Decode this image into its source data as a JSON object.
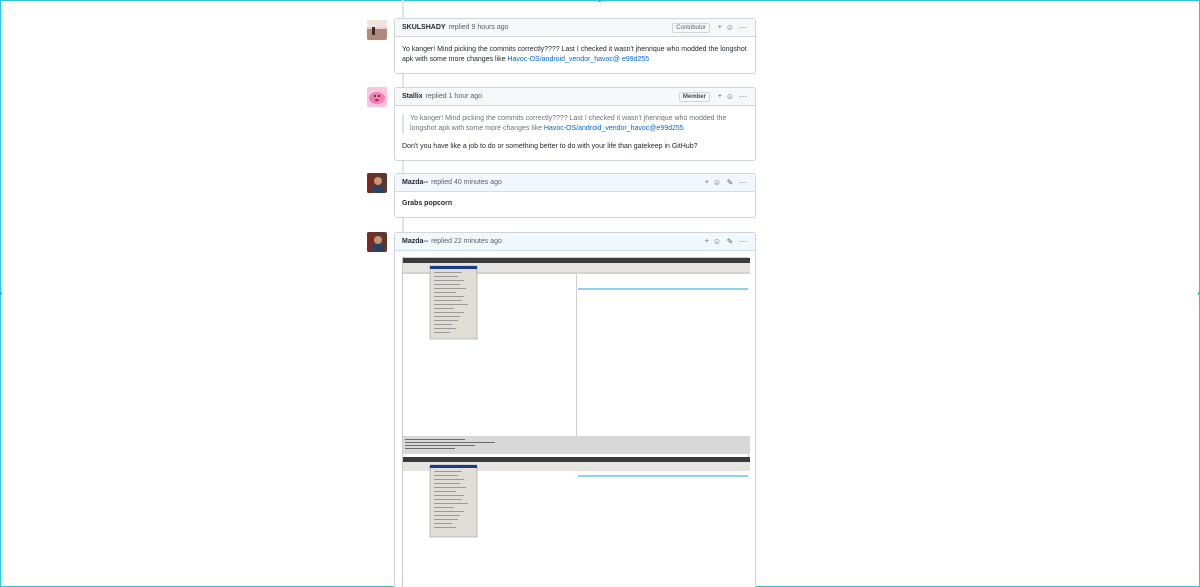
{
  "comments": [
    {
      "author": "SKULSHADY",
      "meta": "replied 9 hours ago",
      "badge": "Contributor",
      "body_text": "Yo kanger! Mind picking the commits correctly???? Last I checked it wasn't jhenrique who modded the longshot apk with some more changes like ",
      "body_link": "Havoc-OS/android_vendor_havoc@ e99d255"
    },
    {
      "author": "Stallix",
      "meta": "replied 1 hour ago",
      "badge": "Member",
      "quote_text": "Yo kanger! Mind picking the commits correctly???? Last I checked it wasn't jhenrique who modded the longshot apk with some more changes like ",
      "quote_link": "Havoc-OS/android_vendor_havoc@e99d255",
      "body_text": "Don't you have like a job to do or something better to do with your life than gatekeep in GitHub?"
    },
    {
      "author": "Mazda--",
      "meta": "replied 40 minutes ago",
      "body_text": "Grabs popcorn"
    },
    {
      "author": "Mazda--",
      "meta": "replied 22 minutes ago"
    }
  ],
  "icons": {
    "add_reaction": "smiley-plus-icon",
    "more": "kebab-horizontal-icon",
    "edit": "pencil-icon"
  },
  "colors": {
    "link": "#0366d6",
    "header_gray": "#f6f8fa",
    "header_blue": "#f1f8ff",
    "border": "#d1d5da"
  }
}
